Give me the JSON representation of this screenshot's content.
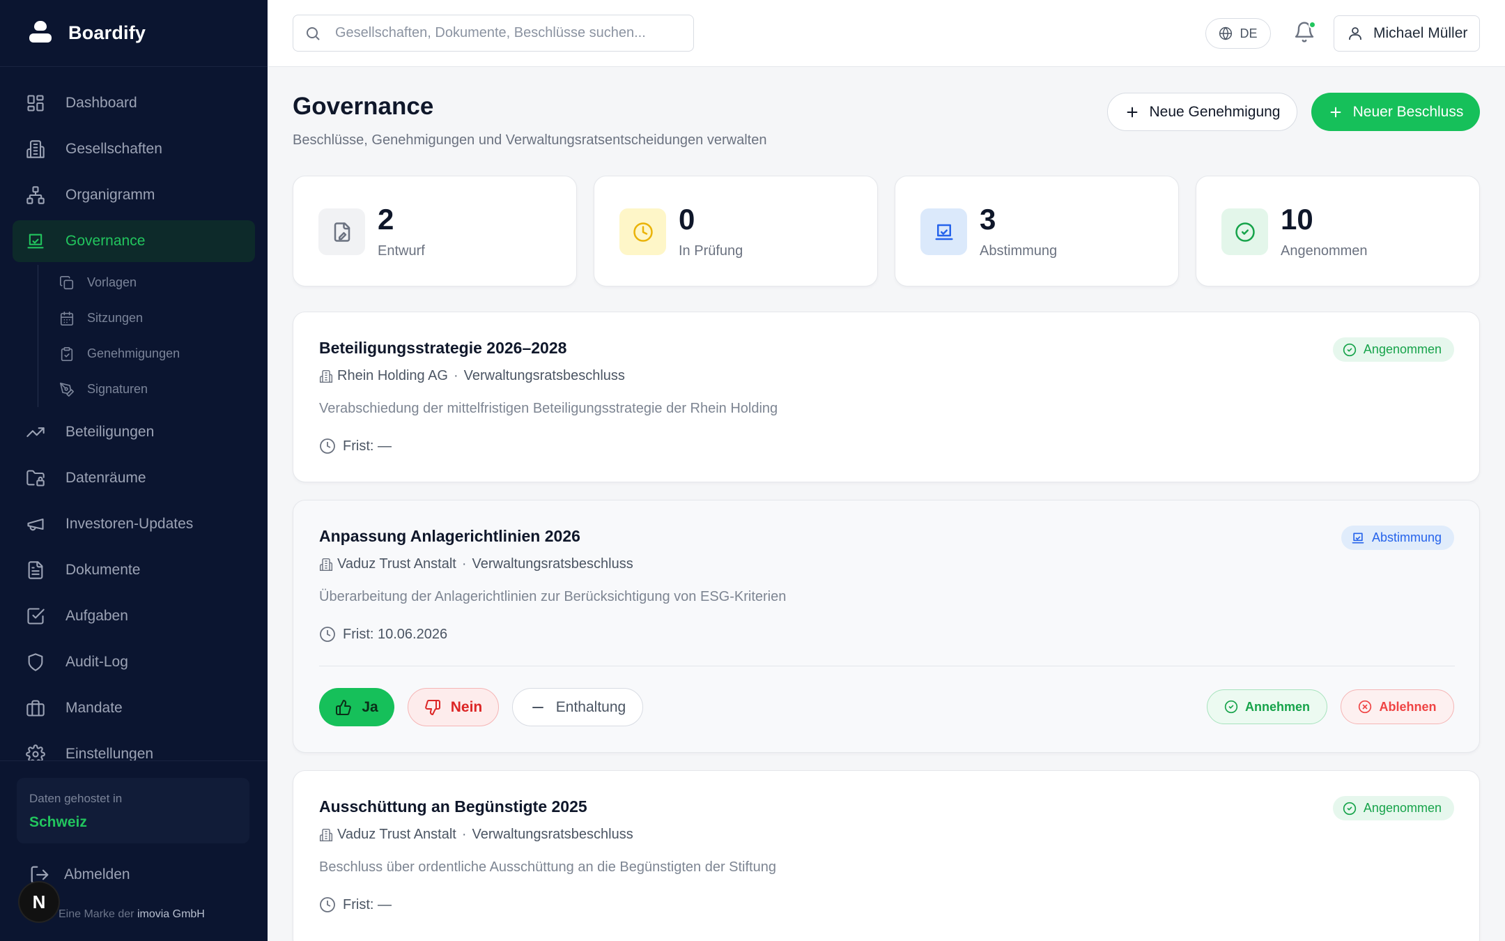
{
  "app": {
    "name": "Boardify"
  },
  "sidebar": {
    "items": [
      {
        "label": "Dashboard",
        "icon": "dashboard-icon"
      },
      {
        "label": "Gesellschaften",
        "icon": "building-icon"
      },
      {
        "label": "Organigramm",
        "icon": "org-chart-icon"
      },
      {
        "label": "Governance",
        "icon": "check-square-icon",
        "active": true
      },
      {
        "label": "Beteiligungen",
        "icon": "trending-up-icon"
      },
      {
        "label": "Datenräume",
        "icon": "folder-lock-icon"
      },
      {
        "label": "Investoren-Updates",
        "icon": "megaphone-icon"
      },
      {
        "label": "Dokumente",
        "icon": "document-icon"
      },
      {
        "label": "Aufgaben",
        "icon": "checkbox-icon"
      },
      {
        "label": "Audit-Log",
        "icon": "shield-icon"
      },
      {
        "label": "Mandate",
        "icon": "briefcase-icon"
      },
      {
        "label": "Einstellungen",
        "icon": "gear-icon"
      }
    ],
    "subitems": [
      {
        "label": "Vorlagen",
        "icon": "copy-icon"
      },
      {
        "label": "Sitzungen",
        "icon": "calendar-icon"
      },
      {
        "label": "Genehmigungen",
        "icon": "clipboard-icon"
      },
      {
        "label": "Signaturen",
        "icon": "pen-icon"
      }
    ],
    "hosting": {
      "label": "Daten gehostet in",
      "value": "Schweiz"
    },
    "logout": "Abmelden",
    "footer_prefix": "Eine Marke der",
    "footer_company": "imovia GmbH",
    "badge_letter": "N"
  },
  "topbar": {
    "search_placeholder": "Gesellschaften, Dokumente, Beschlüsse suchen...",
    "language": "DE",
    "user_name": "Michael Müller"
  },
  "page": {
    "title": "Governance",
    "subtitle": "Beschlüsse, Genehmigungen und Verwaltungsratsentscheidungen verwalten",
    "btn_new_approval": "Neue Genehmigung",
    "btn_new_resolution": "Neuer Beschluss"
  },
  "stats": [
    {
      "value": "2",
      "label": "Entwurf",
      "color": "#6b7280",
      "bg": "#f1f2f4"
    },
    {
      "value": "0",
      "label": "In Prüfung",
      "color": "#eab308",
      "bg": "#fef6c8"
    },
    {
      "value": "3",
      "label": "Abstimmung",
      "color": "#2563eb",
      "bg": "#dbe9fb"
    },
    {
      "value": "10",
      "label": "Angenommen",
      "color": "#16a34a",
      "bg": "#e3f6ea"
    }
  ],
  "resolutions": [
    {
      "title": "Beteiligungsstrategie 2026–2028",
      "company": "Rhein Holding AG",
      "type": "Verwaltungsratsbeschluss",
      "description": "Verabschiedung der mittelfristigen Beteiligungsstrategie der Rhein Holding",
      "deadline": "Frist: —",
      "status": "Angenommen"
    },
    {
      "title": "Anpassung Anlagerichtlinien 2026",
      "company": "Vaduz Trust Anstalt",
      "type": "Verwaltungsratsbeschluss",
      "description": "Überarbeitung der Anlagerichtlinien zur Berücksichtigung von ESG-Kriterien",
      "deadline": "Frist: 10.06.2026",
      "status": "Abstimmung",
      "vote_yes": "Ja",
      "vote_no": "Nein",
      "vote_abstain": "Enthaltung",
      "accept": "Annehmen",
      "reject": "Ablehnen"
    },
    {
      "title": "Ausschüttung an Begünstigte 2025",
      "company": "Vaduz Trust Anstalt",
      "type": "Verwaltungsratsbeschluss",
      "description": "Beschluss über ordentliche Ausschüttung an die Begünstigten der Stiftung",
      "deadline": "Frist: —",
      "status": "Angenommen"
    }
  ]
}
